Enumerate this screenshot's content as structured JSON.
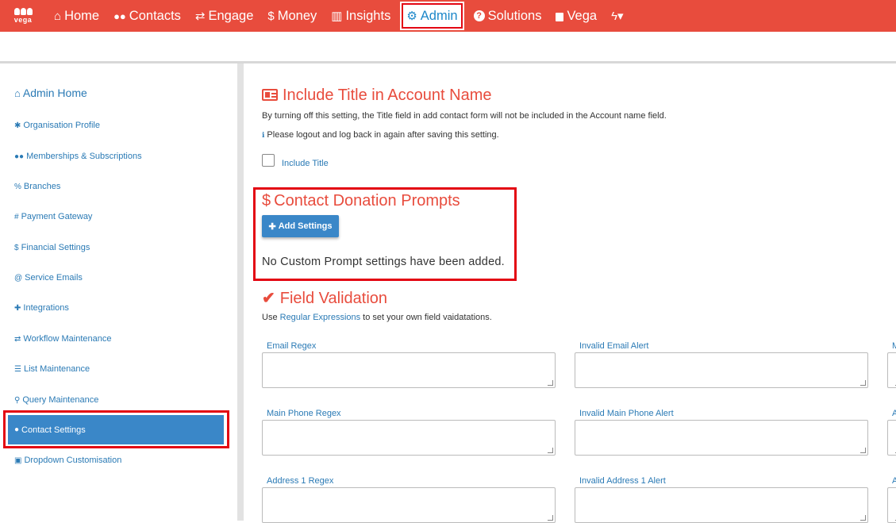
{
  "topnav": {
    "logo_text": "vega",
    "items": [
      {
        "label": "Home",
        "icon": "home-icon",
        "glyph": "⌂"
      },
      {
        "label": "Contacts",
        "icon": "users-icon",
        "glyph": "👥"
      },
      {
        "label": "Engage",
        "icon": "exchange-icon",
        "glyph": "⇄"
      },
      {
        "label": "Money",
        "icon": "dollar-icon",
        "glyph": "$"
      },
      {
        "label": "Insights",
        "icon": "bar-chart-icon",
        "glyph": "▥"
      },
      {
        "label": "Admin",
        "icon": "cogs-icon",
        "glyph": "⚙"
      },
      {
        "label": "Solutions",
        "icon": "question-circle-icon",
        "glyph": "?"
      },
      {
        "label": "Vega",
        "icon": "lock-icon",
        "glyph": "🔒"
      },
      {
        "label": "",
        "icon": "bolt-icon",
        "glyph": "ϟ▾"
      }
    ],
    "active": "Admin"
  },
  "sidebar": {
    "home": {
      "label": "Admin Home",
      "glyph": "⌂"
    },
    "items": [
      {
        "label": "Organisation Profile",
        "glyph": "✱",
        "icon": "cog-icon"
      },
      {
        "label": "Memberships & Subscriptions",
        "glyph": "👥",
        "icon": "users-icon"
      },
      {
        "label": "Branches",
        "glyph": "%",
        "icon": "branch-icon"
      },
      {
        "label": "Payment Gateway",
        "glyph": "#",
        "icon": "hash-icon"
      },
      {
        "label": "Financial Settings",
        "glyph": "$",
        "icon": "dollar-icon"
      },
      {
        "label": "Service Emails",
        "glyph": "@",
        "icon": "at-icon"
      },
      {
        "label": "Integrations",
        "glyph": "✚",
        "icon": "puzzle-icon"
      },
      {
        "label": "Workflow Maintenance",
        "glyph": "⇄",
        "icon": "exchange-icon"
      },
      {
        "label": "List Maintenance",
        "glyph": "☰",
        "icon": "list-icon"
      },
      {
        "label": "Query Maintenance",
        "glyph": "⚲",
        "icon": "search-icon"
      },
      {
        "label": "Contact Settings",
        "glyph": "👤",
        "icon": "user-icon"
      },
      {
        "label": "Dropdown Customisation",
        "glyph": "▣",
        "icon": "caret-square-icon"
      }
    ],
    "active": "Contact Settings"
  },
  "include_title": {
    "heading": "Include Title in Account Name",
    "description": "By turning off this setting, the Title field in add contact form will not be included in the Account name field.",
    "note": "Please logout and log back in again after saving this setting.",
    "checkbox_label": "Include Title",
    "checked": false
  },
  "donation": {
    "heading": "Contact Donation Prompts",
    "add_button": "Add Settings",
    "empty_message": "No Custom Prompt settings have been added."
  },
  "validation": {
    "heading": "Field Validation",
    "intro_prefix": "Use ",
    "intro_link": "Regular Expressions",
    "intro_suffix": " to set your own field vaidatations.",
    "fields": [
      {
        "left": "Email Regex",
        "right": "Invalid Email Alert",
        "edge": "M"
      },
      {
        "left": "Main Phone Regex",
        "right": "Invalid Main Phone Alert",
        "edge": "A"
      },
      {
        "left": "Address 1 Regex",
        "right": "Invalid Address 1 Alert",
        "edge": "A"
      }
    ]
  },
  "colors": {
    "brand": "#e84c3d",
    "link": "#2a7ab5",
    "active": "#3a87c8",
    "highlight": "#e30613"
  }
}
